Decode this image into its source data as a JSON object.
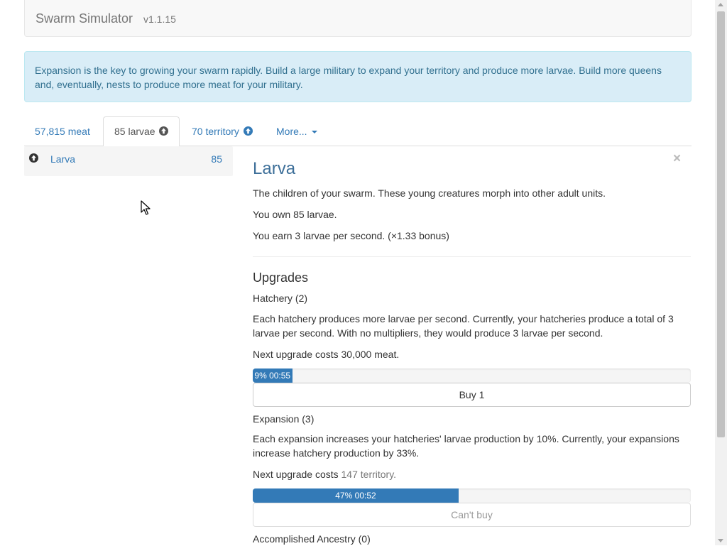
{
  "header": {
    "brand": "Swarm Simulator",
    "version": "v1.1.15"
  },
  "alert": {
    "text": "Expansion is the key to growing your swarm rapidly. Build a large military to expand your territory and produce more larvae. Build more queens and, eventually, nests to produce more meat for your military."
  },
  "tabs": [
    {
      "label": "57,815 meat",
      "icon": null,
      "active": false
    },
    {
      "label": "85 larvae",
      "icon": "arrow-up-circle-icon",
      "active": true
    },
    {
      "label": "70 territory",
      "icon": "arrow-up-circle-icon",
      "active": false
    },
    {
      "label": "More...",
      "icon": "caret-down-icon",
      "active": false
    }
  ],
  "sidebar": {
    "items": [
      {
        "label": "Larva",
        "count": "85",
        "icon": "arrow-up-circle-icon"
      }
    ]
  },
  "detail": {
    "title": "Larva",
    "description": "The children of your swarm. These young creatures morph into other adult units.",
    "owned": "You own 85 larvae.",
    "rate": "You earn 3 larvae per second. (×1.33 bonus)",
    "close_label": "×",
    "upgrades_heading": "Upgrades",
    "upgrades": [
      {
        "name": "Hatchery (2)",
        "description": "Each hatchery produces more larvae per second. Currently, your hatcheries produce a total of 3 larvae per second. With no multipliers, they would produce 3 larvae per second.",
        "cost_prefix": "Next upgrade costs ",
        "cost_value": "30,000 meat.",
        "progress_label": "9% 00:55",
        "progress_value": 9,
        "button_label": "Buy 1",
        "button_enabled": true
      },
      {
        "name": "Expansion (3)",
        "description": "Each expansion increases your hatcheries' larvae production by 10%. Currently, your expansions increase hatchery production by 33%.",
        "cost_prefix": "Next upgrade costs ",
        "cost_value": "147 territory.",
        "progress_label": "47% 00:52",
        "progress_value": 47,
        "button_label": "Can't buy",
        "button_enabled": false
      },
      {
        "name": "Accomplished Ancestry (0)"
      }
    ]
  },
  "colors": {
    "link": "#337ab7",
    "alert_bg": "#d9edf7",
    "alert_text": "#31708f",
    "progress_bar": "#337ab7"
  }
}
